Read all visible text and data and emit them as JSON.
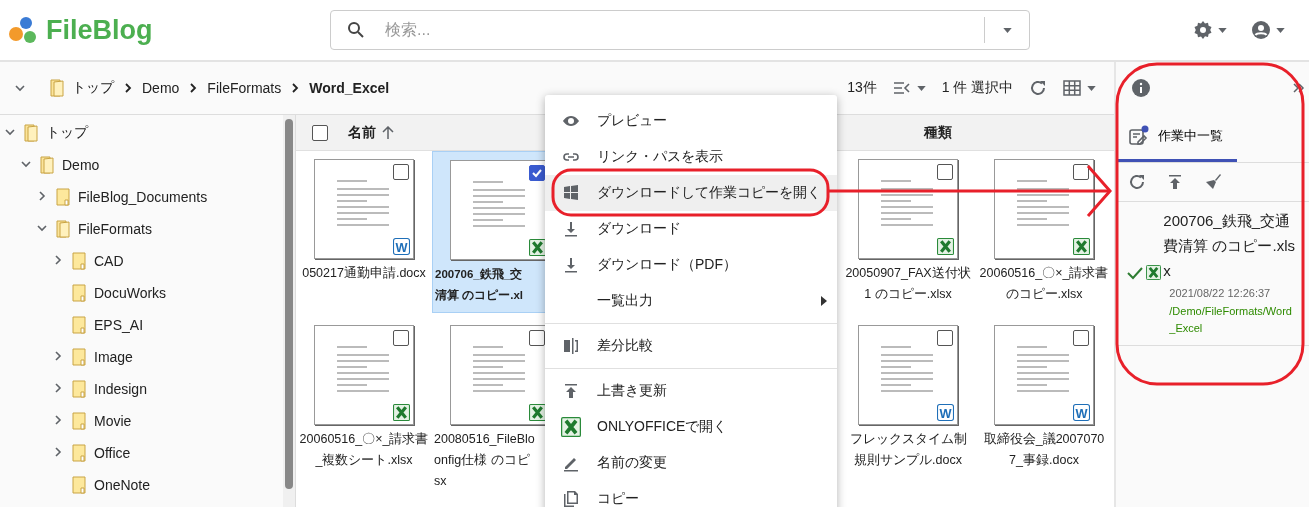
{
  "header": {
    "logo": "FileBlog",
    "search": {
      "placeholder": "検索..."
    }
  },
  "toolbar": {
    "breadcrumb": [
      {
        "label": "トップ",
        "current": false
      },
      {
        "label": "Demo",
        "current": false
      },
      {
        "label": "FileFormats",
        "current": false
      },
      {
        "label": "Word_Excel",
        "current": true
      }
    ],
    "count": "13件",
    "selection": "1 件 選択中"
  },
  "tree": [
    {
      "label": "トップ",
      "expandable": true,
      "expanded": true,
      "children": [
        {
          "label": "Demo",
          "expandable": true,
          "expanded": true,
          "children": [
            {
              "label": "FileBlog_Documents",
              "expandable": true,
              "expanded": false
            },
            {
              "label": "FileFormats",
              "expandable": true,
              "expanded": true,
              "children": [
                {
                  "label": "CAD",
                  "expandable": true,
                  "expanded": false
                },
                {
                  "label": "DocuWorks",
                  "expandable": false,
                  "expanded": false
                },
                {
                  "label": "EPS_AI",
                  "expandable": false,
                  "expanded": false
                },
                {
                  "label": "Image",
                  "expandable": true,
                  "expanded": false
                },
                {
                  "label": "Indesign",
                  "expandable": true,
                  "expanded": false
                },
                {
                  "label": "Movie",
                  "expandable": true,
                  "expanded": false
                },
                {
                  "label": "Office",
                  "expandable": true,
                  "expanded": false
                },
                {
                  "label": "OneNote",
                  "expandable": false,
                  "expanded": false
                }
              ]
            }
          ]
        }
      ]
    }
  ],
  "grid": {
    "all_checked": false,
    "columns": [
      {
        "label": "名前",
        "sorted": true
      },
      {
        "label": "種類",
        "sorted": false
      }
    ],
    "rows": [
      {
        "left": [
          {
            "lines": [
              "050217通勤申請.docx"
            ],
            "kind": "word",
            "badge": "W",
            "checked": false,
            "selected": false
          },
          {
            "lines": [
              "200706_鉄飛_交",
              "清算 のコピー.xl"
            ],
            "kind": "excel",
            "checked": true,
            "selected": true
          }
        ],
        "right": [
          {
            "lines": [
              "20050907_FAX送付状",
              "1 のコピー.xlsx"
            ],
            "kind": "excel",
            "checked": false,
            "selected": false
          },
          {
            "lines": [
              "20060516_〇×_請求書",
              "のコピー.xlsx"
            ],
            "kind": "excel",
            "checked": false,
            "selected": false
          }
        ]
      },
      {
        "left": [
          {
            "lines": [
              "20060516_〇×_請求書",
              "_複数シート.xlsx"
            ],
            "kind": "excel",
            "checked": false,
            "selected": false
          },
          {
            "lines": [
              "20080516_FileBlo",
              "onfig仕様 のコピ",
              "sx"
            ],
            "kind": "excel",
            "checked": false,
            "selected": false
          }
        ],
        "right": [
          {
            "lines": [
              "フレックスタイム制",
              "規則サンプル.docx"
            ],
            "kind": "word",
            "badge": "W",
            "checked": false,
            "selected": false
          },
          {
            "lines": [
              "取締役会_議2007070",
              "7_事録.docx"
            ],
            "kind": "word",
            "badge": "W",
            "checked": false,
            "selected": false
          }
        ]
      }
    ]
  },
  "context_menu": {
    "groups": [
      [
        {
          "label": "プレビュー",
          "kind": "preview",
          "highlighted": false,
          "submenu": false
        },
        {
          "label": "リンク・パスを表示",
          "kind": "link",
          "highlighted": false,
          "submenu": false
        },
        {
          "label": "ダウンロードして作業コピーを開く",
          "kind": "windows",
          "highlighted": true,
          "submenu": false
        },
        {
          "label": "ダウンロード",
          "kind": "download",
          "highlighted": false,
          "submenu": false
        },
        {
          "label": "ダウンロード（PDF）",
          "kind": "download",
          "highlighted": false,
          "submenu": false
        },
        {
          "label": "一覧出力",
          "kind": "none",
          "highlighted": false,
          "submenu": true
        }
      ],
      [
        {
          "label": "差分比較",
          "kind": "compare",
          "highlighted": false,
          "submenu": false
        }
      ],
      [
        {
          "label": "上書き更新",
          "kind": "upload",
          "highlighted": false,
          "submenu": false
        },
        {
          "label": "ONLYOFFICEで開く",
          "kind": "excel",
          "highlighted": false,
          "submenu": false
        },
        {
          "label": "名前の変更",
          "kind": "rename",
          "highlighted": false,
          "submenu": false
        },
        {
          "label": "コピー",
          "kind": "copy",
          "highlighted": false,
          "submenu": false
        }
      ]
    ]
  },
  "side_panel": {
    "tabs": [
      {
        "label": "作業中一覧",
        "selected": true,
        "badge": true
      }
    ],
    "items": [
      {
        "name": "200706_鉄飛_交通費清算 のコピー.xlsx",
        "done": true,
        "kind": "excel",
        "date": "2021/08/22 12:26:37",
        "path": "/Demo/FileFormats/Word_Excel"
      }
    ]
  }
}
